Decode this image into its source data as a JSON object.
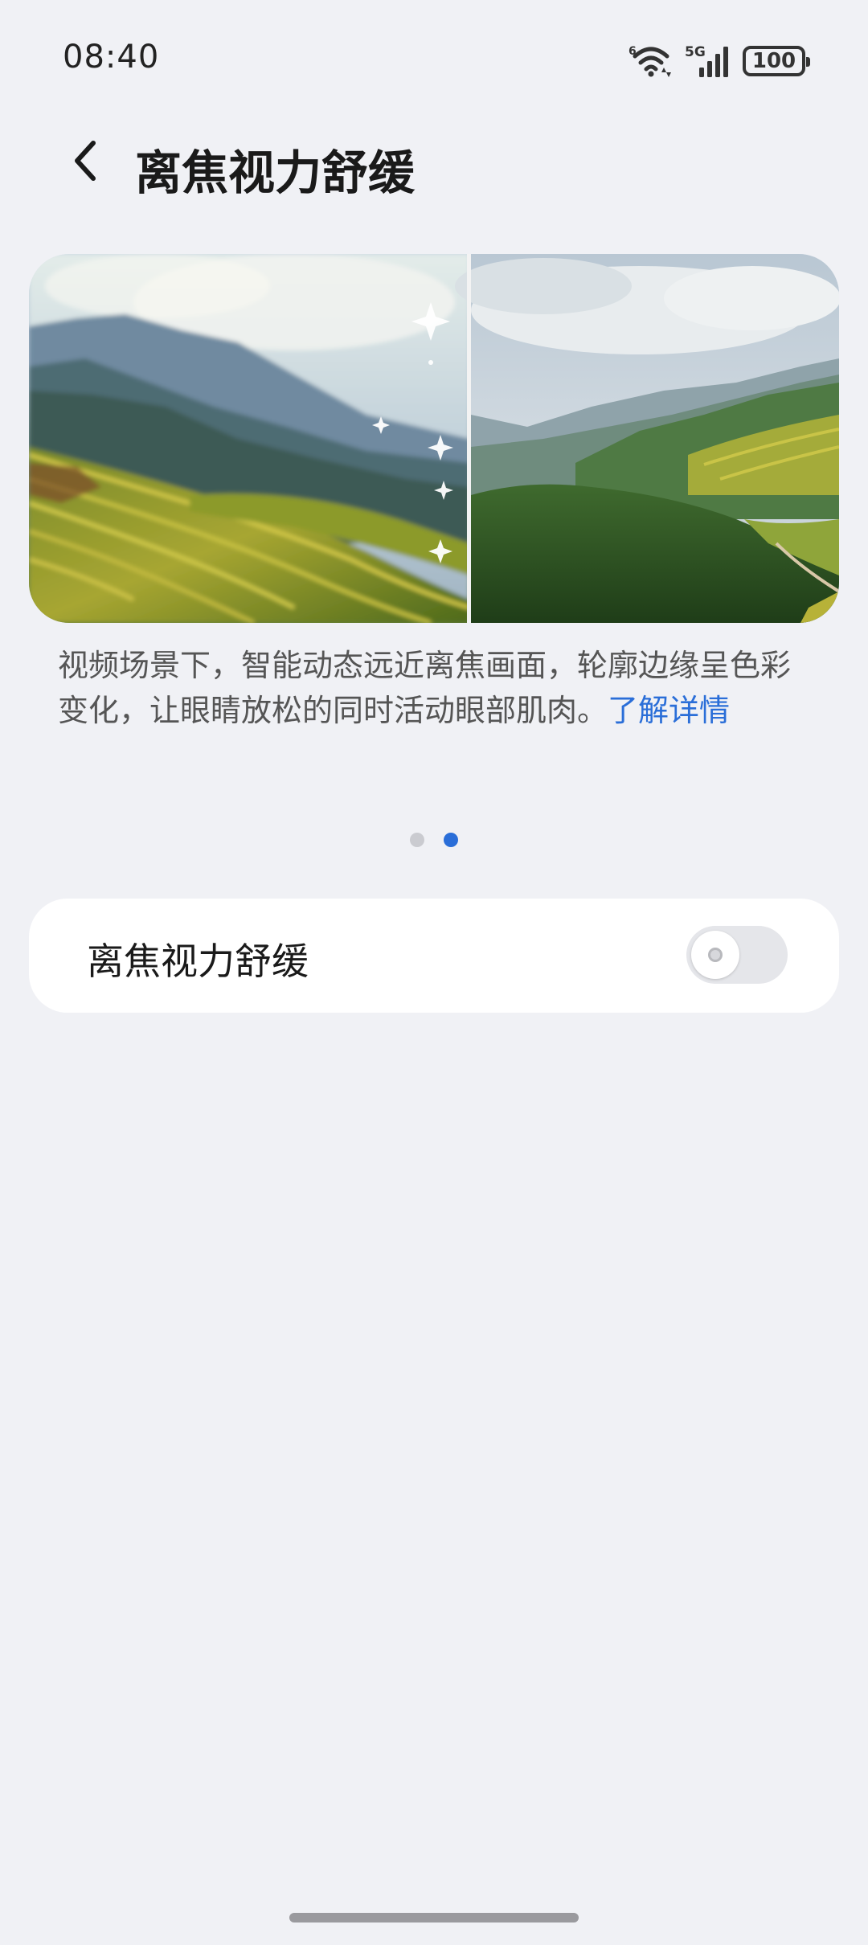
{
  "status_bar": {
    "time": "08:40",
    "wifi_badge": "6",
    "network_label": "5G",
    "battery": "100",
    "icons": [
      "wifi-icon",
      "signal-icon",
      "battery-icon"
    ]
  },
  "header": {
    "back_icon": "chevron-left-icon",
    "title": "离焦视力舒缓"
  },
  "banner": {
    "image_left": "blurred-terraced-fields-landscape",
    "image_right": "sharp-mountain-valley-landscape",
    "sparkle_icon": "sparkle-icon"
  },
  "description": {
    "text": "视频场景下，智能动态远近离焦画面，轮廓边缘呈色彩变化，让眼睛放松的同时活动眼部肌肉。",
    "link": "了解详情"
  },
  "pager": {
    "count": 2,
    "active_index": 1
  },
  "setting": {
    "label": "离焦视力舒缓",
    "toggle_on": false
  },
  "colors": {
    "background": "#f0f1f5",
    "accent": "#2a6ed8",
    "card": "#ffffff",
    "toggle_off": "#e5e6ea"
  }
}
